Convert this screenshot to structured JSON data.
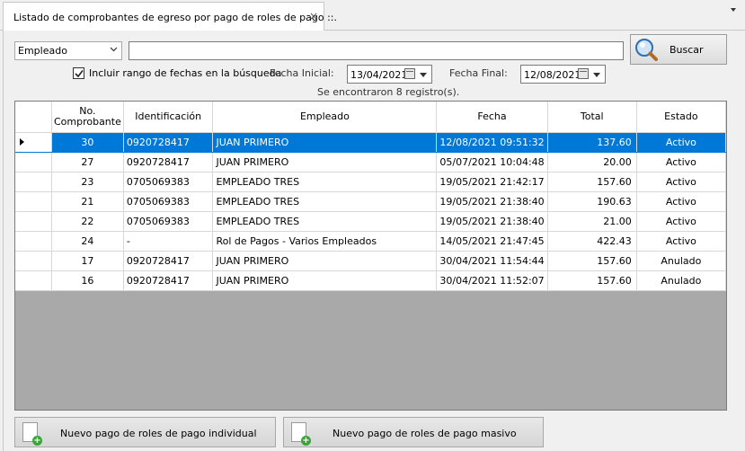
{
  "tab": {
    "title": "Listado de comprobantes de egreso por pago de roles de pago ::.",
    "close": "×"
  },
  "search": {
    "field_selected": "Empleado",
    "query": "",
    "button_label": "Buscar"
  },
  "filters": {
    "include_dates_label": "Incluir rango de fechas en la búsqueda",
    "include_dates_checked": true,
    "start_label": "Fecha Inicial:",
    "start_value": "13/04/2021",
    "end_label": "Fecha Final:",
    "end_value": "12/08/2021"
  },
  "result_text": "Se encontraron 8 registro(s).",
  "table": {
    "columns": [
      "No. Comprobante",
      "Identificación",
      "Empleado",
      "Fecha",
      "Total",
      "Estado"
    ],
    "rows": [
      [
        "30",
        "0920728417",
        "JUAN PRIMERO",
        "12/08/2021 09:51:32",
        "137.60",
        "Activo"
      ],
      [
        "27",
        "0920728417",
        "JUAN PRIMERO",
        "05/07/2021 10:04:48",
        "20.00",
        "Activo"
      ],
      [
        "23",
        "0705069383",
        "EMPLEADO TRES",
        "19/05/2021 21:42:17",
        "157.60",
        "Activo"
      ],
      [
        "21",
        "0705069383",
        "EMPLEADO TRES",
        "19/05/2021 21:38:40",
        "190.63",
        "Activo"
      ],
      [
        "22",
        "0705069383",
        "EMPLEADO TRES",
        "19/05/2021 21:38:40",
        "21.00",
        "Activo"
      ],
      [
        "24",
        "-",
        "Rol de Pagos - Varios Empleados",
        "14/05/2021 21:47:45",
        "422.43",
        "Activo"
      ],
      [
        "17",
        "0920728417",
        "JUAN PRIMERO",
        "30/04/2021 11:54:44",
        "157.60",
        "Anulado"
      ],
      [
        "16",
        "0920728417",
        "JUAN PRIMERO",
        "30/04/2021 11:52:07",
        "157.60",
        "Anulado"
      ]
    ]
  },
  "buttons": {
    "new_individual": "Nuevo pago de roles de pago individual",
    "new_massive": "Nuevo pago de roles de pago masivo"
  },
  "colors": {
    "selection": "#0078d7",
    "grid_bg": "#a9a9a9"
  },
  "icons": {
    "search": "magnifier-icon",
    "new": "new-document-plus-icon",
    "calendar": "calendar-icon"
  }
}
